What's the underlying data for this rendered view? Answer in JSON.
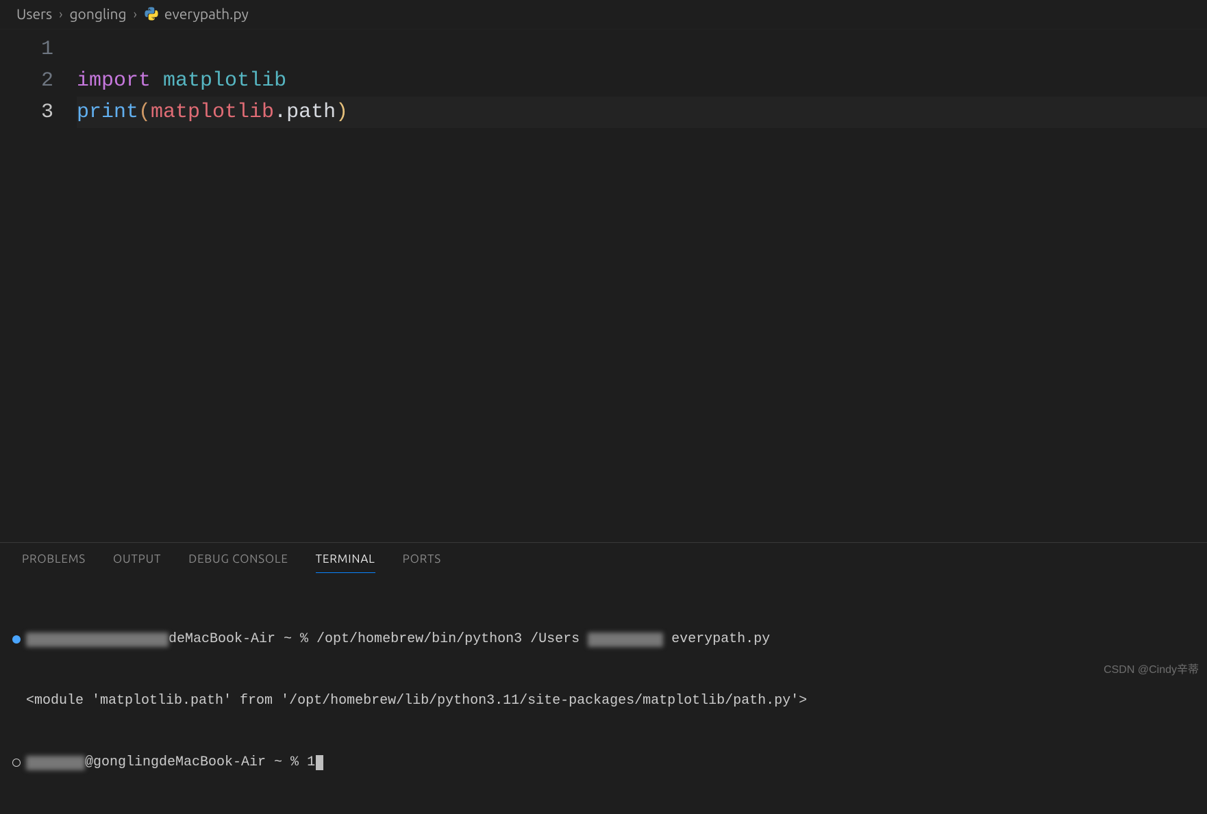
{
  "breadcrumb": {
    "items": [
      "Users",
      "gongling",
      "everypath.py"
    ]
  },
  "editor": {
    "line_numbers": [
      "1",
      "2",
      "3"
    ],
    "active_line": 3,
    "code": {
      "l2": {
        "kw": "import",
        "sp": " ",
        "mod": "matplotlib"
      },
      "l3": {
        "fn": "print",
        "open": "(",
        "obj": "matplotlib",
        "dot": ".",
        "prop": "path",
        "close": ")"
      }
    }
  },
  "panel": {
    "tabs": [
      "PROBLEMS",
      "OUTPUT",
      "DEBUG CONSOLE",
      "TERMINAL",
      "PORTS"
    ],
    "active_tab": "TERMINAL",
    "terminal": {
      "line1_host": "deMacBook-Air ~ % ",
      "line1_cmd": "/opt/homebrew/bin/python3 /Users",
      "line1_tail": " everypath.py",
      "line2": "<module 'matplotlib.path' from '/opt/homebrew/lib/python3.11/site-packages/matplotlib/path.py'>",
      "line3_host": "@gonglingdeMacBook-Air ~ % ",
      "line3_cmd": "1"
    }
  },
  "watermark": "CSDN @Cindy辛蒂"
}
